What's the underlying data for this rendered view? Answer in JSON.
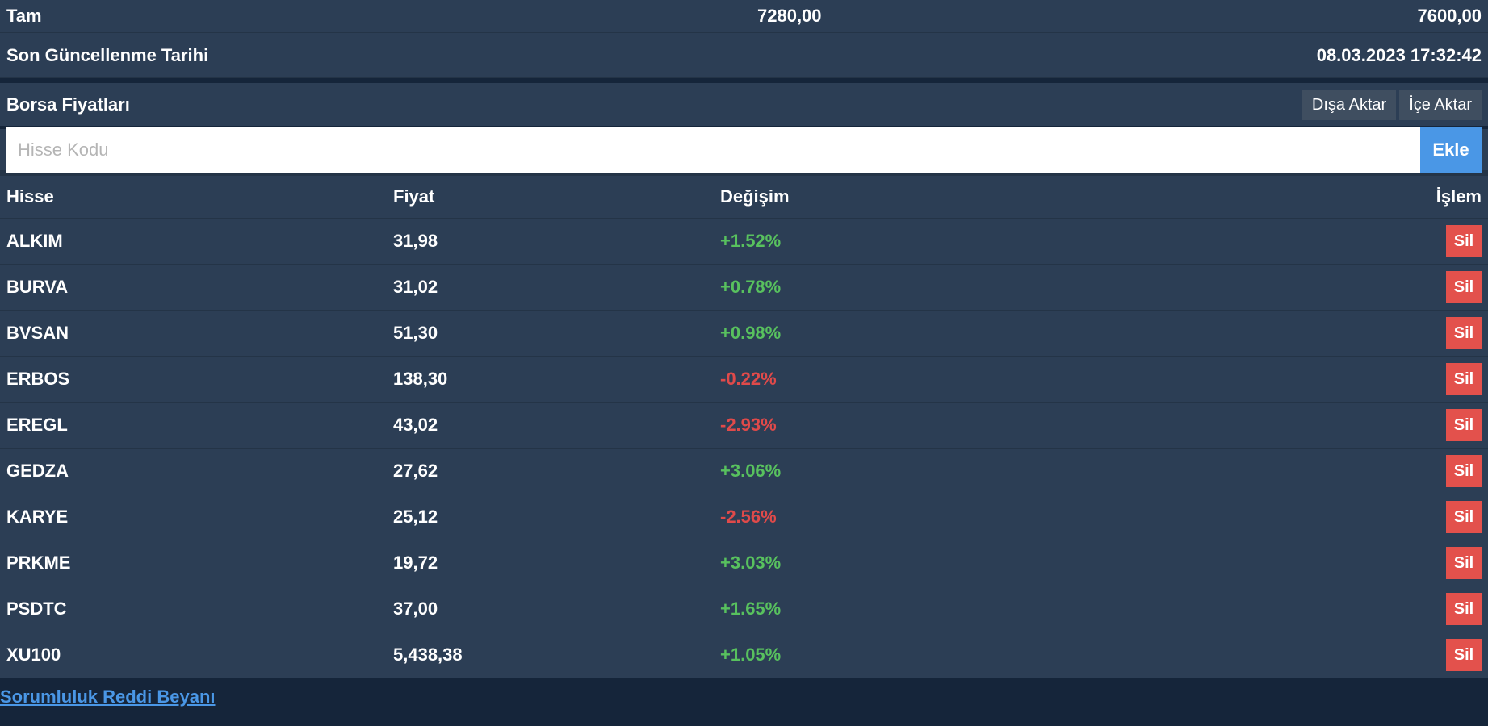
{
  "gold_row": {
    "name": "Tam",
    "buy": "7280,00",
    "sell": "7600,00"
  },
  "updated": {
    "label": "Son Güncellenme Tarihi",
    "value": "08.03.2023 17:32:42"
  },
  "stocks_panel": {
    "title": "Borsa Fiyatları",
    "export_label": "Dışa Aktar",
    "import_label": "İçe Aktar",
    "input_placeholder": "Hisse Kodu",
    "add_label": "Ekle",
    "columns": [
      "Hisse",
      "Fiyat",
      "Değişim",
      "İşlem"
    ],
    "delete_label": "Sil",
    "rows": [
      {
        "code": "ALKIM",
        "price": "31,98",
        "change": "+1.52%",
        "trend": "up"
      },
      {
        "code": "BURVA",
        "price": "31,02",
        "change": "+0.78%",
        "trend": "up"
      },
      {
        "code": "BVSAN",
        "price": "51,30",
        "change": "+0.98%",
        "trend": "up"
      },
      {
        "code": "ERBOS",
        "price": "138,30",
        "change": "-0.22%",
        "trend": "down"
      },
      {
        "code": "EREGL",
        "price": "43,02",
        "change": "-2.93%",
        "trend": "down"
      },
      {
        "code": "GEDZA",
        "price": "27,62",
        "change": "+3.06%",
        "trend": "up"
      },
      {
        "code": "KARYE",
        "price": "25,12",
        "change": "-2.56%",
        "trend": "down"
      },
      {
        "code": "PRKME",
        "price": "19,72",
        "change": "+3.03%",
        "trend": "up"
      },
      {
        "code": "PSDTC",
        "price": "37,00",
        "change": "+1.65%",
        "trend": "up"
      },
      {
        "code": "XU100",
        "price": "5,438,38",
        "change": "+1.05%",
        "trend": "up"
      }
    ]
  },
  "footer": {
    "disclaimer_link": "Sorumluluk Reddi Beyanı"
  },
  "colors": {
    "background": "#15253a",
    "panel": "#2c3e55",
    "positive": "#58c15e",
    "negative": "#e04a4a",
    "accent": "#4a97e6",
    "delete": "#e3514c"
  }
}
